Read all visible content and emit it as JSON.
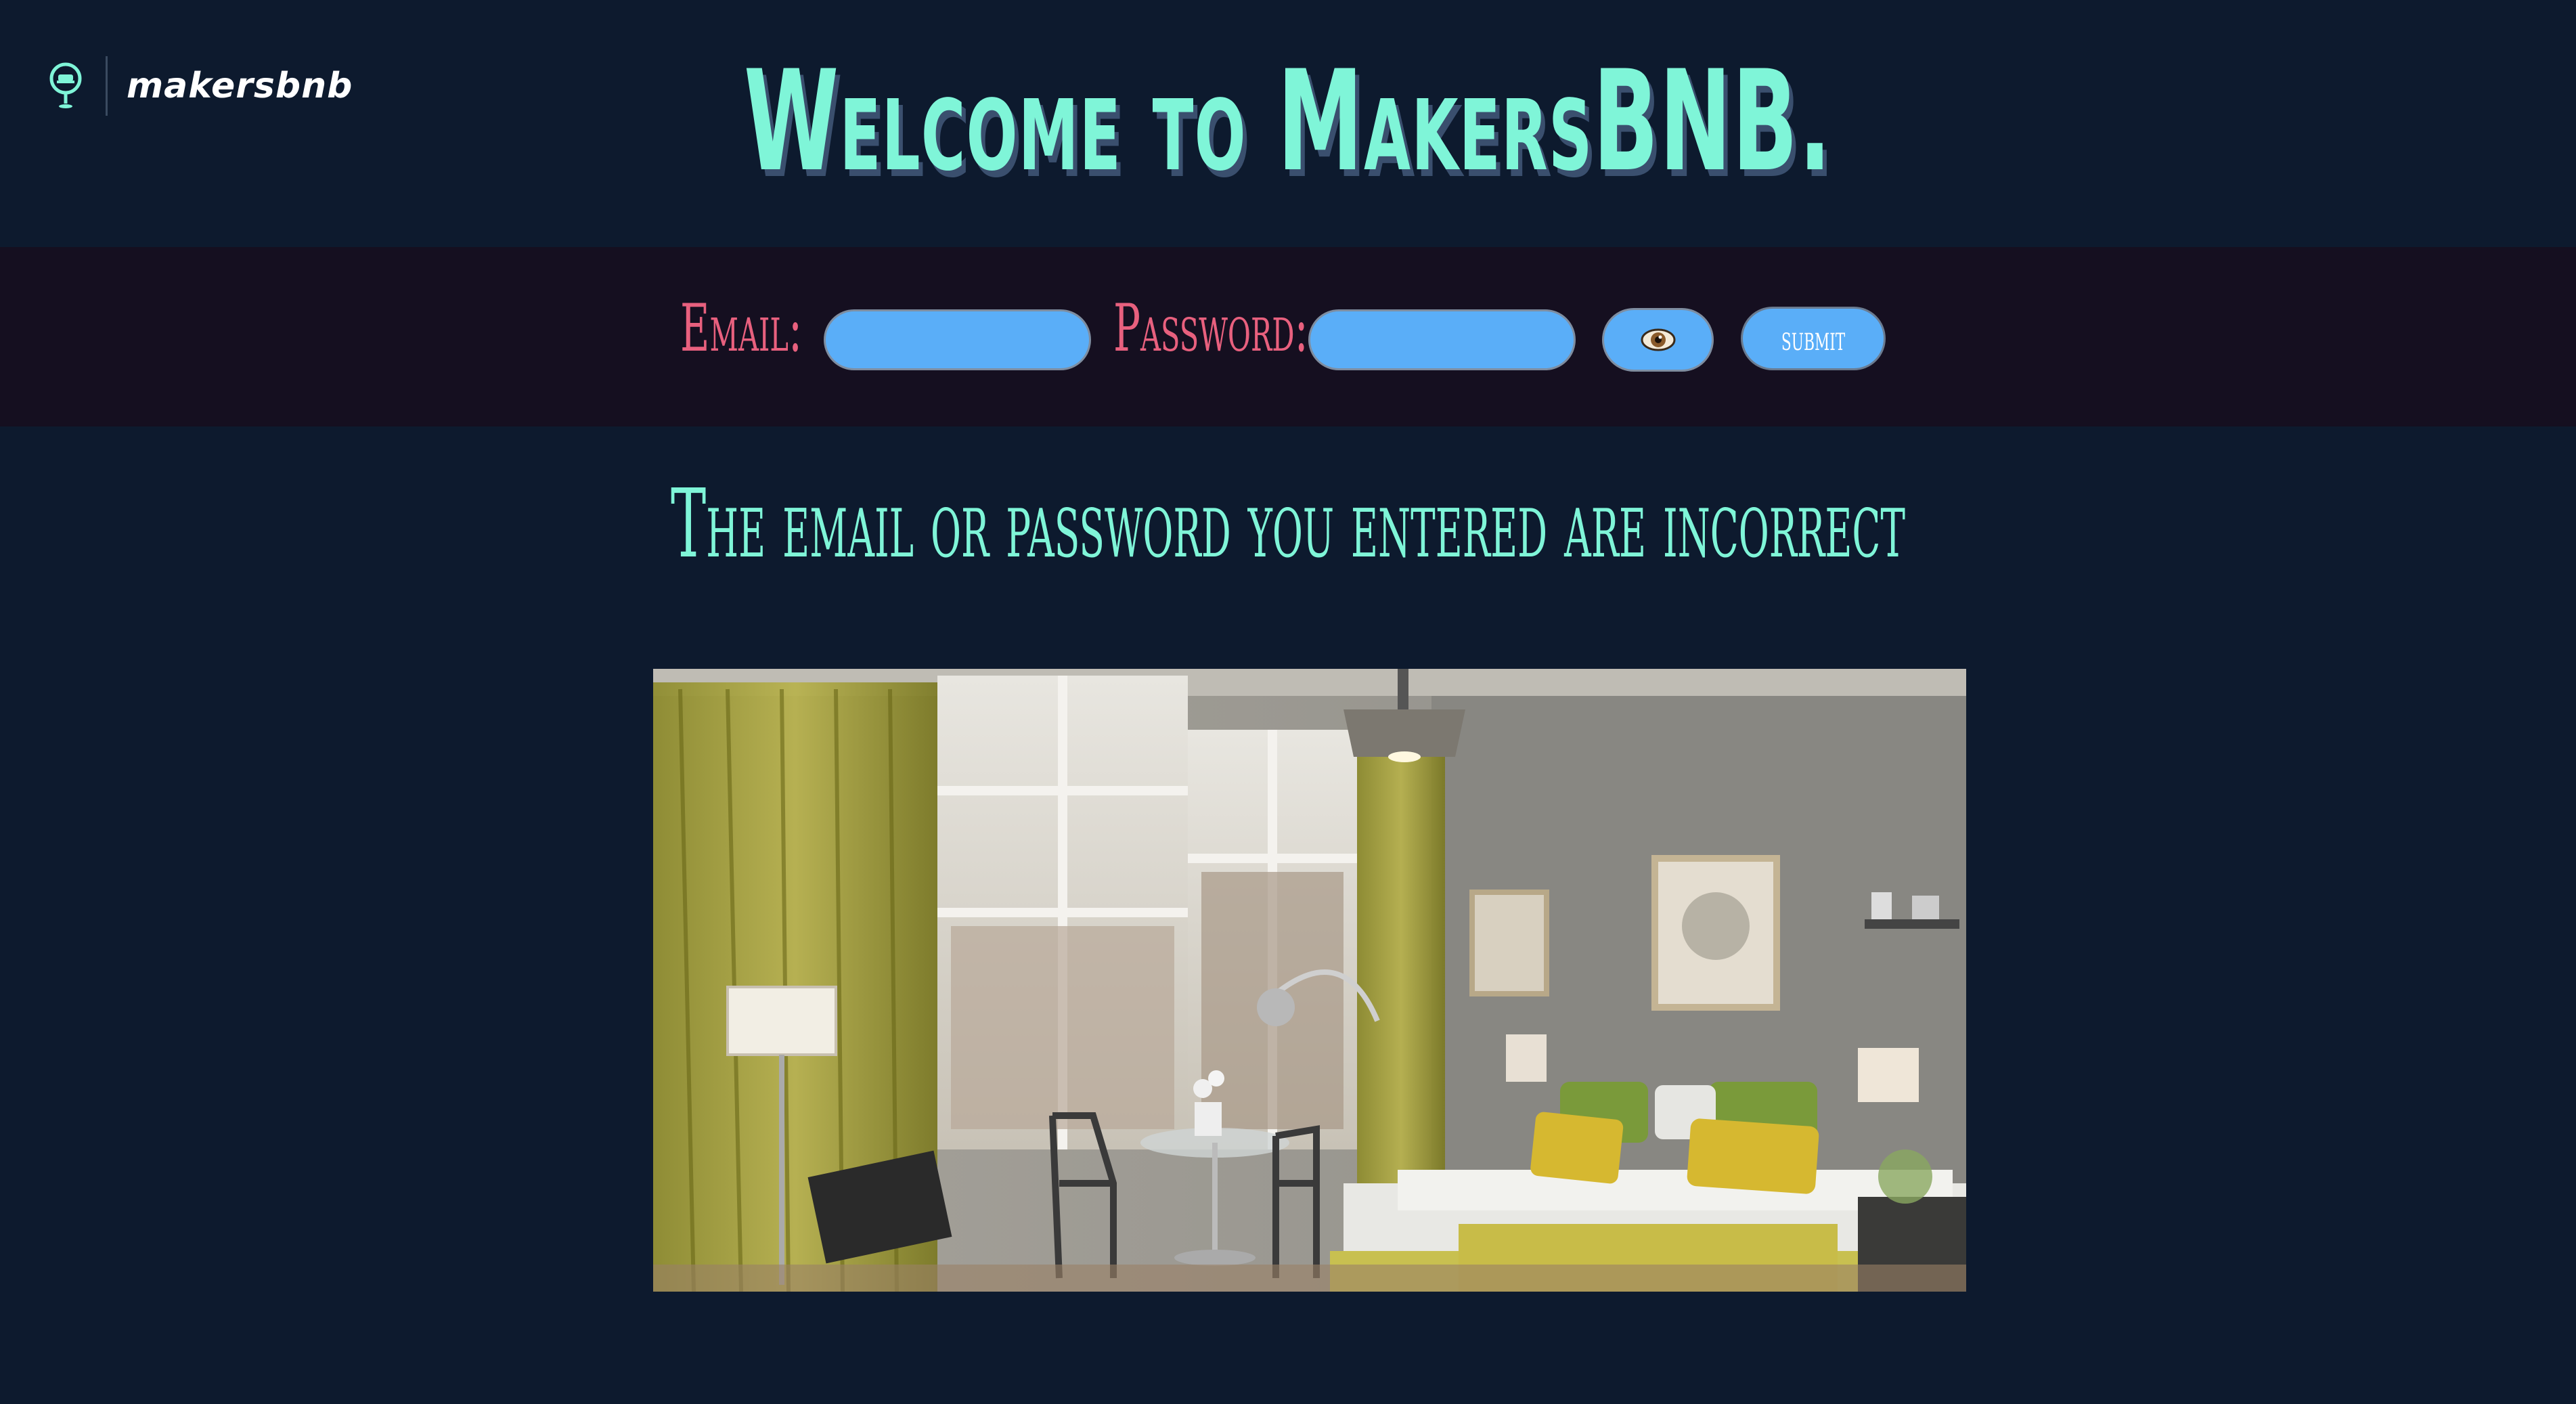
{
  "brand": {
    "logo_text": "makersbnb",
    "logo_icon": "map-pin-bed-icon"
  },
  "page": {
    "title": "Welcome to MakersBNB."
  },
  "login_form": {
    "email_label": "Email:",
    "email_value": "",
    "password_label": "Password:",
    "password_value": "",
    "show_password_icon": "eye-icon",
    "submit_label": "submit"
  },
  "message": {
    "error_text": "The email or password you entered are incorrect"
  },
  "hero": {
    "image_subject": "hotel-room-photo"
  },
  "colors": {
    "background": "#0d1a2e",
    "accent": "#7ff5d8",
    "label": "#e8607e",
    "input": "#5aaef8"
  }
}
